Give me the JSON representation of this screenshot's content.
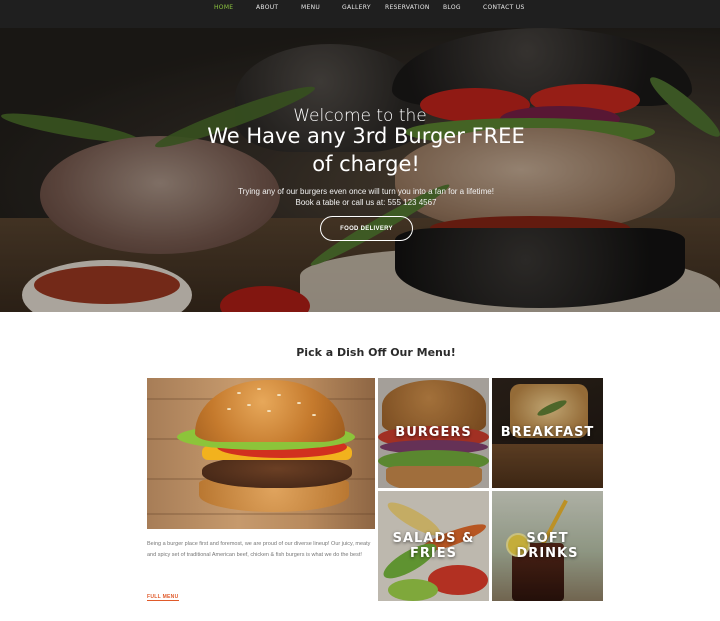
{
  "nav": {
    "items": [
      {
        "label": "HOME",
        "active": true
      },
      {
        "label": "ABOUT",
        "active": false
      },
      {
        "label": "MENU",
        "active": false
      },
      {
        "label": "GALLERY",
        "active": false
      },
      {
        "label": "RESERVATION",
        "active": false
      },
      {
        "label": "BLOG",
        "active": false
      },
      {
        "label": "CONTACT US",
        "active": false
      }
    ],
    "active_color": "#8dc63f"
  },
  "hero": {
    "subtitle": "Welcome to the",
    "title_line1": "We Have any 3rd Burger FREE",
    "title_line2": "of charge!",
    "desc_line1": "Trying any of our burgers even once will turn you into a fan for a lifetime!",
    "desc_line2": "Book a table or call us at: 555 123 4567",
    "button_label": "FOOD DELIVERY"
  },
  "menu_section": {
    "title": "Pick a Dish Off Our Menu!",
    "feature_text": "Being a burger place first and foremost, we are proud of our diverse lineup! Our juicy, meaty and spicy set of traditional American beef, chicken & fish burgers is what we do the best!",
    "feature_link": "FULL MENU",
    "link_color": "#e05a2a",
    "tiles": [
      {
        "label": "BURGERS"
      },
      {
        "label": "BREAKFAST"
      },
      {
        "label_line1": "SALADS &",
        "label_line2": "FRIES"
      },
      {
        "label_line1": "SOFT",
        "label_line2": "DRINKS"
      }
    ]
  }
}
